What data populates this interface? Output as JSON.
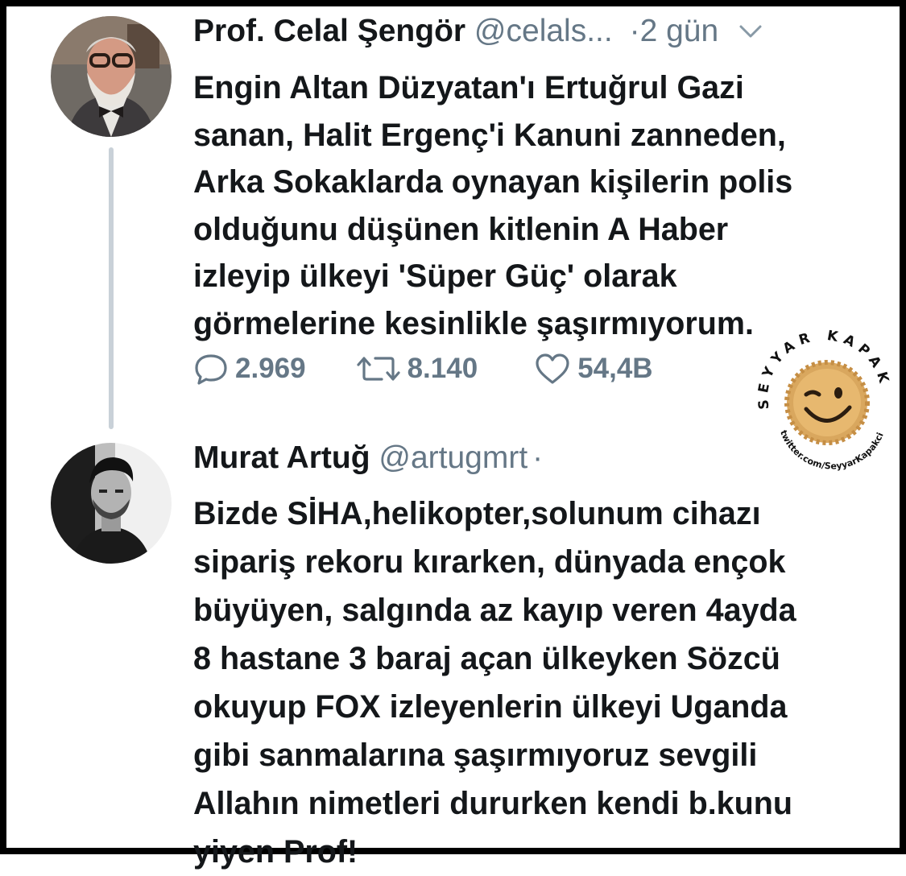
{
  "tweets": [
    {
      "name": "Prof. Celal Şengör",
      "handle": "@celals...",
      "dot": "·",
      "time": "2 gün",
      "text": "Engin Altan Düzyatan'ı Ertuğrul Gazi\nsanan, Halit Ergenç'i Kanuni zanneden,\nArka Sokaklarda oynayan kişilerin polis\nolduğunu düşünen kitlenin A Haber\nizleyip ülkeyi 'Süper Güç' olarak\ngörmelerine kesinlikle şaşırmıyorum.",
      "replies": "2.969",
      "retweets": "8.140",
      "likes": "54,4B"
    },
    {
      "name": "Murat Artuğ",
      "handle": "@artugmrt",
      "dot": "·",
      "text": "Bizde SİHA,helikopter,solunum cihazı\nsipariş rekoru kırarken, dünyada ençok\nbüyüyen, salgında az kayıp veren 4ayda\n8 hastane 3 baraj açan ülkeyken Sözcü\nokuyup FOX izleyenlerin ülkeyi Uganda\ngibi sanmalarına şaşırmıyoruz sevgili\nAllahın nimetleri dururken kendi b.kunu\nyiyen Prof!"
    }
  ],
  "watermark": {
    "arc_text": "SEYYAR KAPAKÇI",
    "url_text": "twitter.com/SeyyarKapakci"
  },
  "colors": {
    "text": "#14171a",
    "muted": "#657786",
    "thread_line": "#c9d1d8",
    "frame": "#000000",
    "cap": "#d9a75e"
  }
}
